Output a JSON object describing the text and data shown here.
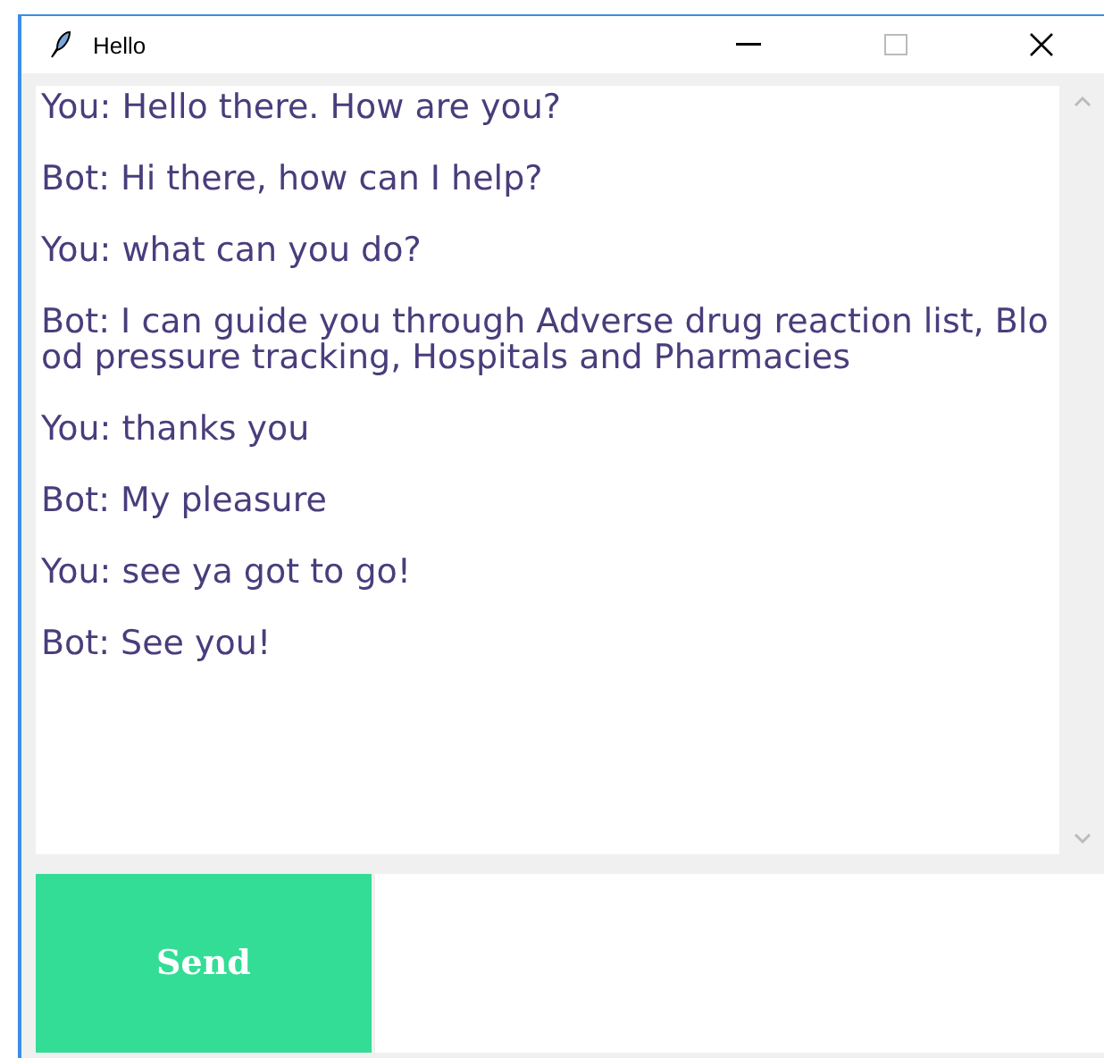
{
  "window": {
    "title": "Hello"
  },
  "messages": [
    "You: Hello there. How are you?",
    "Bot: Hi there, how can I help?",
    "You: what can you do?",
    "Bot: I can guide you through Adverse drug reaction list, Blood pressure tracking, Hospitals and Pharmacies",
    "You: thanks you",
    "Bot: My pleasure",
    "You: see ya got to go!",
    "Bot: See you!"
  ],
  "send_button": {
    "label": "Send"
  }
}
